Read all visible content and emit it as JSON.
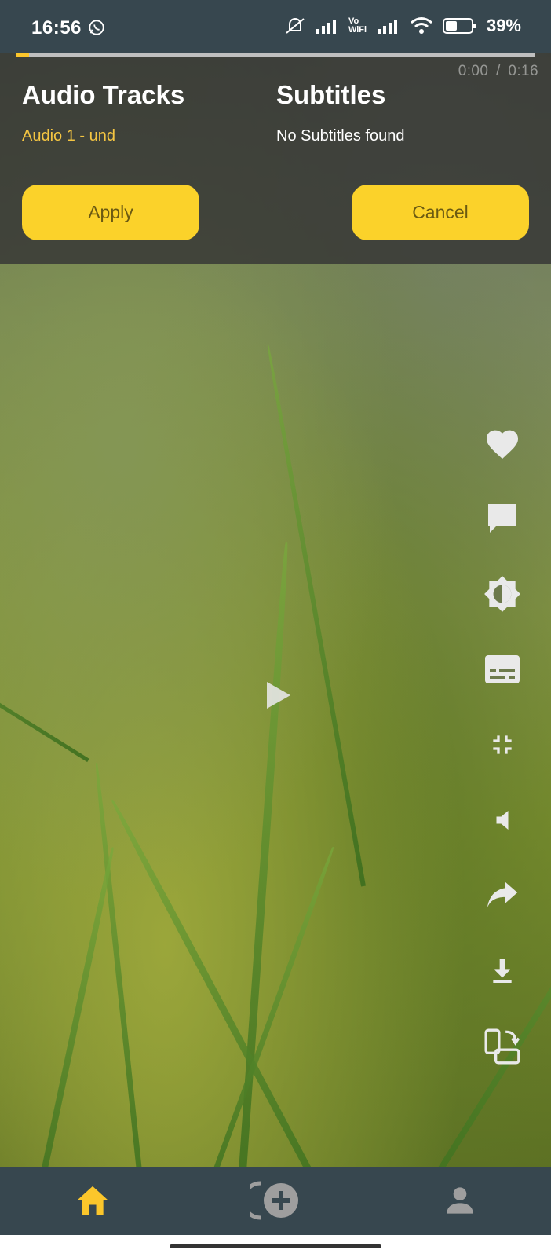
{
  "status_bar": {
    "time": "16:56",
    "network_label": "Vo WiFi",
    "battery": "39%"
  },
  "player": {
    "progress_percent": 2.5,
    "current_time": "0:00",
    "separator": "/",
    "duration": "0:16"
  },
  "tracks_panel": {
    "audio_title": "Audio Tracks",
    "audio_items": [
      "Audio 1 - und"
    ],
    "subtitles_title": "Subtitles",
    "subtitles_message": "No Subtitles found",
    "apply_label": "Apply",
    "cancel_label": "Cancel"
  },
  "side_actions": [
    {
      "icon": "heart-icon"
    },
    {
      "icon": "comment-icon"
    },
    {
      "icon": "brightness-icon"
    },
    {
      "icon": "subtitles-icon"
    },
    {
      "icon": "exit-fullscreen-icon"
    },
    {
      "icon": "volume-icon"
    },
    {
      "icon": "share-icon"
    },
    {
      "icon": "download-icon"
    },
    {
      "icon": "rotate-screen-icon"
    }
  ],
  "bottom_nav": [
    {
      "icon": "home-icon",
      "active": true
    },
    {
      "icon": "add-circle-icon",
      "active": false
    },
    {
      "icon": "profile-icon",
      "active": false
    }
  ],
  "colors": {
    "accent": "#fbd22a",
    "audio_item": "#f4c542",
    "bar_background": "#37474f"
  }
}
